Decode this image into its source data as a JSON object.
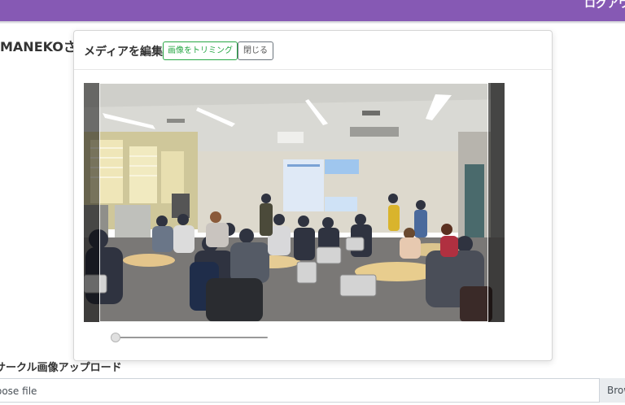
{
  "topbar": {
    "right_text": "ログアウ"
  },
  "page": {
    "title": "MANEKOさ",
    "upload_label": "サークル画像アップロード",
    "file_input_text": "oose file",
    "browse_label": "Brow"
  },
  "modal": {
    "title": "メディアを編集",
    "trim_button": "画像をトリミング",
    "close_button": "閉じる"
  },
  "zoom": {
    "level": 0
  },
  "colors": {
    "topbar": "#8659b4",
    "trim_button": "#28a745"
  }
}
